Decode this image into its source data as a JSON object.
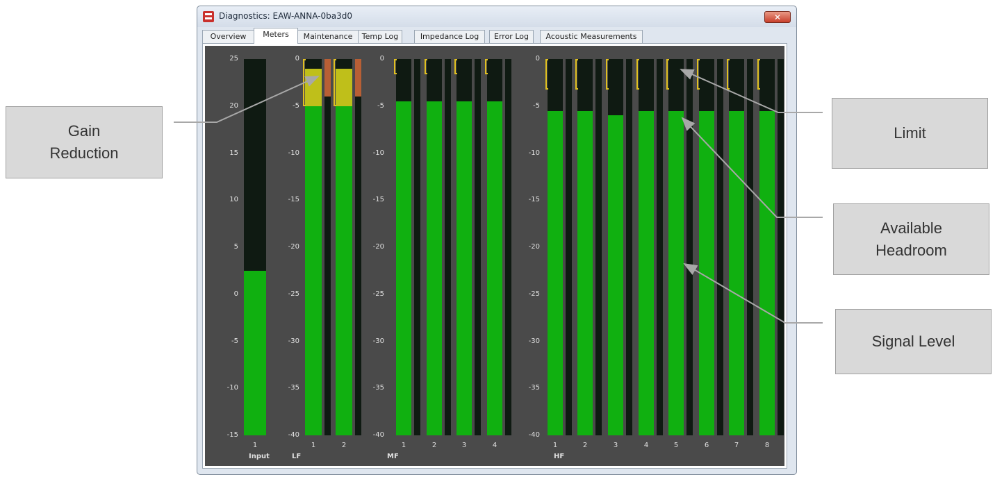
{
  "window": {
    "title": "Diagnostics: EAW-ANNA-0ba3d0",
    "close_label": "✕"
  },
  "tabs": [
    "Overview",
    "Meters",
    "Maintenance",
    "Temp Log",
    "Impedance Log",
    "Error Log",
    "Acoustic Measurements"
  ],
  "active_tab": "Meters",
  "meters": {
    "input": {
      "label": "Input",
      "scale": [
        "25",
        "20",
        "15",
        "10",
        "5",
        "0",
        "-5",
        "-10",
        "-15"
      ],
      "channels": [
        {
          "n": "1",
          "level": 2.5
        }
      ]
    },
    "lf": {
      "label": "LF",
      "scale": [
        "0",
        "-5",
        "-10",
        "-15",
        "-20",
        "-25",
        "-30",
        "-35",
        "-40"
      ],
      "channels": [
        {
          "n": "1",
          "level": -5,
          "gain_reduction": 4
        },
        {
          "n": "2",
          "level": -5,
          "gain_reduction": 4
        }
      ]
    },
    "mf": {
      "label": "MF",
      "scale": [
        "0",
        "-5",
        "-10",
        "-15",
        "-20",
        "-25",
        "-30",
        "-35",
        "-40"
      ],
      "channels": [
        {
          "n": "1",
          "level": -4.5
        },
        {
          "n": "2",
          "level": -4.5
        },
        {
          "n": "3",
          "level": -4.5
        },
        {
          "n": "4",
          "level": -4.5
        }
      ]
    },
    "hf": {
      "label": "HF",
      "scale": [
        "0",
        "-5",
        "-10",
        "-15",
        "-20",
        "-25",
        "-30",
        "-35",
        "-40"
      ],
      "channels": [
        {
          "n": "1",
          "level": -5.5
        },
        {
          "n": "2",
          "level": -5.5
        },
        {
          "n": "3",
          "level": -6
        },
        {
          "n": "4",
          "level": -5.5
        },
        {
          "n": "5",
          "level": -5.5
        },
        {
          "n": "6",
          "level": -5.5
        },
        {
          "n": "7",
          "level": -5.5
        },
        {
          "n": "8",
          "level": -5.5
        }
      ]
    }
  },
  "callouts": {
    "gain_reduction": [
      "Gain",
      "Reduction"
    ],
    "limit": "Limit",
    "available_headroom": [
      "Available",
      "Headroom"
    ],
    "signal_level": "Signal Level"
  },
  "colors": {
    "signal": "#10b010",
    "gain_reduction": "#bfbf1a",
    "limit": "#e0c020",
    "meter_bg": "#0f1a12"
  }
}
